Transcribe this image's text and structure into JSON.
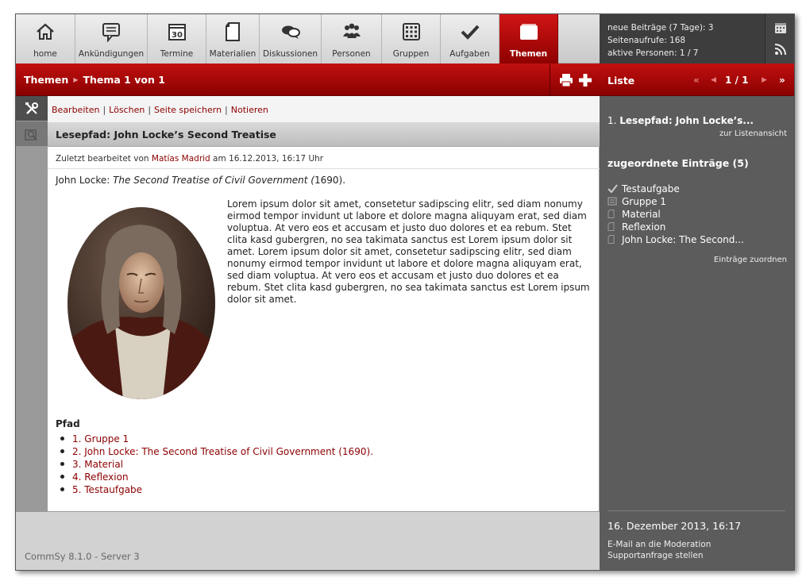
{
  "nav": {
    "items": [
      {
        "label": "home",
        "icon": "home-icon"
      },
      {
        "label": "Ankündigungen",
        "icon": "announcement-icon"
      },
      {
        "label": "Termine",
        "icon": "calendar-icon"
      },
      {
        "label": "Materialien",
        "icon": "material-icon"
      },
      {
        "label": "Diskussionen",
        "icon": "discussion-icon"
      },
      {
        "label": "Personen",
        "icon": "people-icon"
      },
      {
        "label": "Gruppen",
        "icon": "groups-icon"
      },
      {
        "label": "Aufgaben",
        "icon": "task-check-icon"
      },
      {
        "label": "Themen",
        "icon": "topics-folder-icon",
        "active": true
      }
    ],
    "calendar_day": "30"
  },
  "titlebar": {
    "section": "Themen",
    "position": "Thema 1 von 1"
  },
  "actions": {
    "edit": "Bearbeiten",
    "delete": "Löschen",
    "save_page": "Seite speichern",
    "note": "Notieren"
  },
  "item": {
    "title": "Lesepfad: John Locke’s Second Treatise",
    "edited_prefix": "Zuletzt bearbeitet von ",
    "editor": "Matías Madrid",
    "edited_mid": " am ",
    "edited_date": "16.12.2013, 16:17 Uhr",
    "intro_author": "John Locke: ",
    "intro_work": "The Second Treatise of Civil Government (",
    "intro_year": "1690).",
    "body": "Lorem ipsum dolor sit amet, consetetur sadipscing elitr, sed diam nonumy eirmod tempor invidunt ut labore et dolore magna aliquyam erat, sed diam voluptua. At vero eos et accusam et justo duo dolores et ea rebum. Stet clita kasd gubergren, no sea takimata sanctus est Lorem ipsum dolor sit amet. Lorem ipsum dolor sit amet, consetetur sadipscing elitr, sed diam nonumy eirmod tempor invidunt ut labore et dolore magna aliquyam erat, sed diam voluptua. At vero eos et accusam et justo duo dolores et ea rebum. Stet clita kasd gubergren, no sea takimata sanctus est Lorem ipsum dolor sit amet.",
    "path_heading": "Pfad",
    "path": [
      "1. Gruppe 1",
      "2. John Locke: The Second Treatise of Civil Government (1690).",
      "3. Material",
      "4. Reflexion",
      "5. Testaufgabe"
    ]
  },
  "footer": {
    "version": "CommSy 8.1.0 - Server 3"
  },
  "sidebar": {
    "stats": {
      "new_entries": "neue Beiträge (7 Tage): 3",
      "page_views": "Seitenaufrufe: 168",
      "active_people": "aktive Personen: 1 / 7"
    },
    "list_label": "Liste",
    "pager": "1 / 1",
    "current_num": "1. ",
    "current_title": "Lesepfad: John Locke’s...",
    "to_list": "zur Listenansicht",
    "assigned_heading": "zugeordnete Einträge (5)",
    "assigned": [
      {
        "label": "Testaufgabe",
        "icon": "task-check-icon"
      },
      {
        "label": "Gruppe 1",
        "icon": "group-list-icon"
      },
      {
        "label": "Material",
        "icon": "material-doc-icon"
      },
      {
        "label": "Reflexion",
        "icon": "material-doc-icon"
      },
      {
        "label": "John Locke: The Second...",
        "icon": "material-doc-icon"
      }
    ],
    "assign_link": "Einträge zuordnen",
    "datetime": "16. Dezember 2013, 16:17",
    "mail_moderation": "E-Mail an die Moderation",
    "support": "Supportanfrage stellen"
  },
  "colors": {
    "accent": "#b00000",
    "link": "#8c0000",
    "sidebar": "#5c5c5c"
  }
}
